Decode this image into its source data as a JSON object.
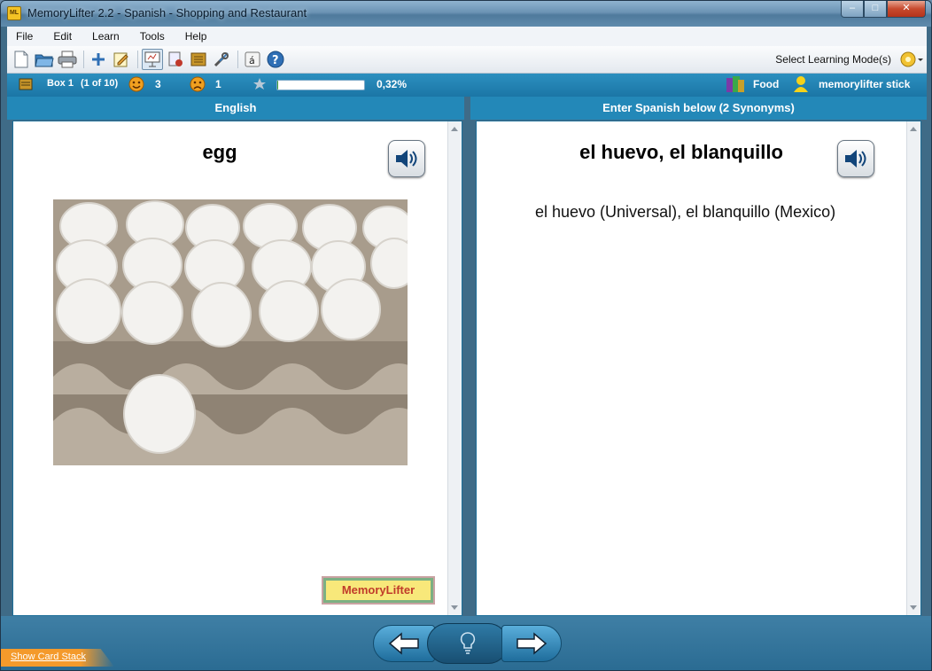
{
  "window": {
    "title": "MemoryLifter 2.2 - Spanish - Shopping and Restaurant",
    "app_icon_text": "ML"
  },
  "menu": [
    "File",
    "Edit",
    "Learn",
    "Tools",
    "Help"
  ],
  "toolbar": {
    "mode_label": "Select Learning Mode(s)"
  },
  "status": {
    "box": "Box 1",
    "box_count": "(1 of 10)",
    "correct": "3",
    "wrong": "1",
    "progress_percent": 0.32,
    "progress_text": "0,32%",
    "chapter": "Food",
    "user": "memorylifter stick"
  },
  "question": {
    "header": "English",
    "word": "egg"
  },
  "answer": {
    "header": "Enter Spanish below (2 Synonyms)",
    "word": "el huevo, el blanquillo",
    "detail": "el huevo (Universal), el blanquillo (Mexico)"
  },
  "logo_text": "MemoryLifter",
  "bottom": {
    "show_stack": "Show Card Stack"
  },
  "colors": {
    "accent": "#2388b8",
    "status_bar": "#1b76a6",
    "logo_bg": "#f8e87a"
  }
}
